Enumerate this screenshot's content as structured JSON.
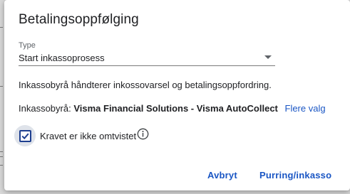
{
  "dialog": {
    "title": "Betalingsoppfølging"
  },
  "type_select": {
    "label": "Type",
    "value": "Start inkassoprosess"
  },
  "info_text": "Inkassobyrå håndterer inkossovarsel og betalingsoppfordring.",
  "agency": {
    "label": "Inkassobyrå:",
    "name": "Visma Financial Solutions - Visma AutoCollect",
    "more_link": "Flere valg"
  },
  "undisputed_checkbox": {
    "label": "Kravet er ikke omtvistet",
    "checked": true
  },
  "buttons": {
    "cancel": "Avbryt",
    "confirm": "Purring/inkasso"
  },
  "colors": {
    "accent": "#1a56c4",
    "checkbox_border": "#1e3f8f",
    "text": "#202124"
  }
}
